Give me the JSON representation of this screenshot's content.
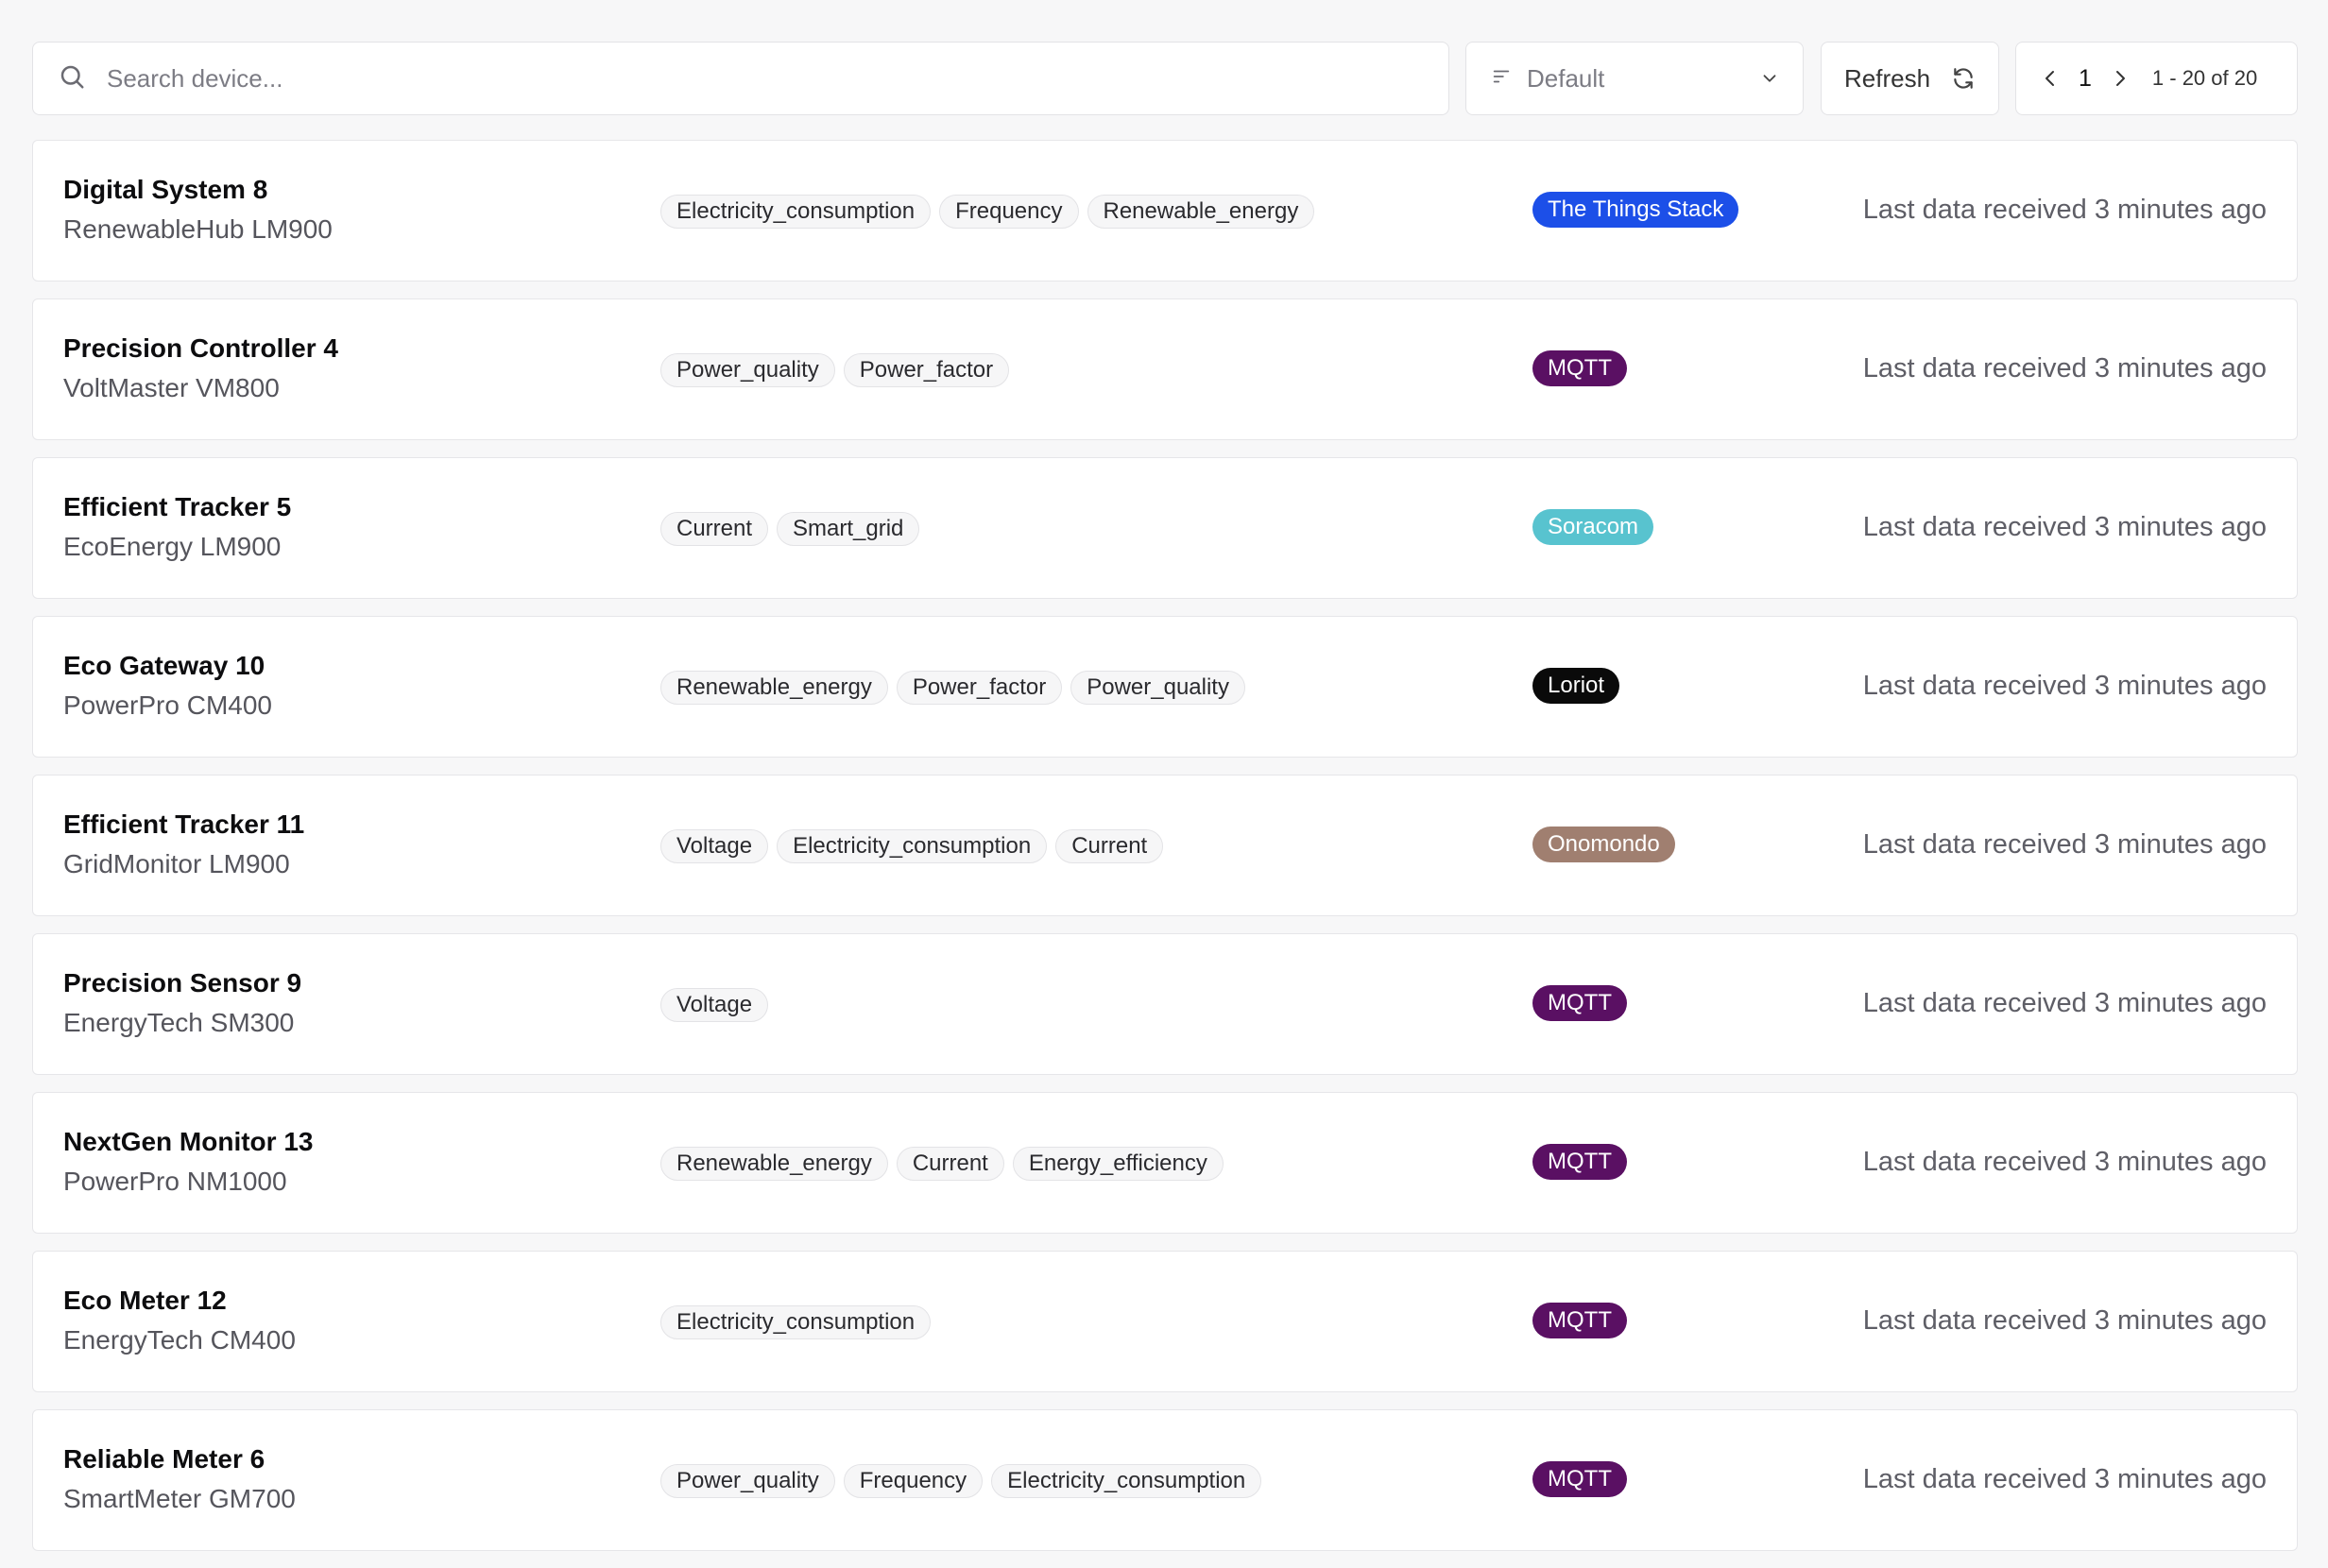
{
  "search": {
    "placeholder": "Search device..."
  },
  "sort": {
    "value": "Default"
  },
  "refresh": {
    "label": "Refresh"
  },
  "pagination": {
    "current_page": "1",
    "range": "1 - 20 of 20"
  },
  "colors": {
    "The Things Stack": "#1c4fe8",
    "MQTT": "#5a1063",
    "Soracom": "#58c3cf",
    "Loriot": "#0a0a0a",
    "Onomondo": "#a07f70"
  },
  "devices": [
    {
      "name": "Digital System 8",
      "model": "RenewableHub LM900",
      "tags": [
        "Electricity_consumption",
        "Frequency",
        "Renewable_energy"
      ],
      "integration": "The Things Stack",
      "last_seen": "Last data received 3 minutes ago"
    },
    {
      "name": "Precision Controller 4",
      "model": "VoltMaster VM800",
      "tags": [
        "Power_quality",
        "Power_factor"
      ],
      "integration": "MQTT",
      "last_seen": "Last data received 3 minutes ago"
    },
    {
      "name": "Efficient Tracker 5",
      "model": "EcoEnergy LM900",
      "tags": [
        "Current",
        "Smart_grid"
      ],
      "integration": "Soracom",
      "last_seen": "Last data received 3 minutes ago"
    },
    {
      "name": "Eco Gateway 10",
      "model": "PowerPro CM400",
      "tags": [
        "Renewable_energy",
        "Power_factor",
        "Power_quality"
      ],
      "integration": "Loriot",
      "last_seen": "Last data received 3 minutes ago"
    },
    {
      "name": "Efficient Tracker 11",
      "model": "GridMonitor LM900",
      "tags": [
        "Voltage",
        "Electricity_consumption",
        "Current"
      ],
      "integration": "Onomondo",
      "last_seen": "Last data received 3 minutes ago"
    },
    {
      "name": "Precision Sensor 9",
      "model": "EnergyTech SM300",
      "tags": [
        "Voltage"
      ],
      "integration": "MQTT",
      "last_seen": "Last data received 3 minutes ago"
    },
    {
      "name": "NextGen Monitor 13",
      "model": "PowerPro NM1000",
      "tags": [
        "Renewable_energy",
        "Current",
        "Energy_efficiency"
      ],
      "integration": "MQTT",
      "last_seen": "Last data received 3 minutes ago"
    },
    {
      "name": "Eco Meter 12",
      "model": "EnergyTech CM400",
      "tags": [
        "Electricity_consumption"
      ],
      "integration": "MQTT",
      "last_seen": "Last data received 3 minutes ago"
    },
    {
      "name": "Reliable Meter 6",
      "model": "SmartMeter GM700",
      "tags": [
        "Power_quality",
        "Frequency",
        "Electricity_consumption"
      ],
      "integration": "MQTT",
      "last_seen": "Last data received 3 minutes ago"
    }
  ]
}
